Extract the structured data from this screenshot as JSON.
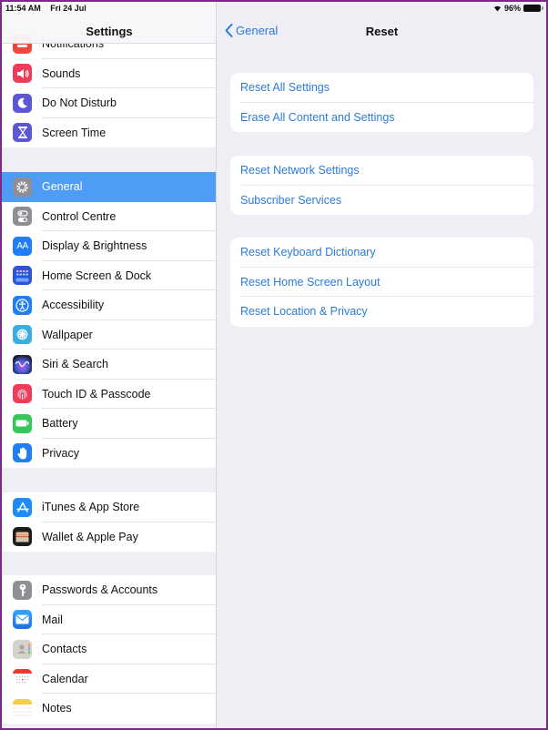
{
  "status_bar": {
    "time": "11:54 AM",
    "date": "Fri 24 Jul",
    "battery_percent": "96%",
    "wifi_icon": "wifi-icon",
    "battery_icon": "battery-icon"
  },
  "master": {
    "title": "Settings",
    "groups": [
      {
        "items": [
          {
            "label": "Notifications",
            "icon": "notifications-icon",
            "color": "#f2453d"
          },
          {
            "label": "Sounds",
            "icon": "speaker-icon",
            "color": "#f03a5a"
          },
          {
            "label": "Do Not Disturb",
            "icon": "moon-icon",
            "color": "#5b57d6"
          },
          {
            "label": "Screen Time",
            "icon": "hourglass-icon",
            "color": "#5b57d6"
          }
        ]
      },
      {
        "items": [
          {
            "label": "General",
            "icon": "gear-icon",
            "color": "#8e8e93",
            "selected": true
          },
          {
            "label": "Control Centre",
            "icon": "toggles-icon",
            "color": "#8e8e93"
          },
          {
            "label": "Display & Brightness",
            "icon": "text-size-icon",
            "color": "#1f7ef5"
          },
          {
            "label": "Home Screen & Dock",
            "icon": "home-grid-icon",
            "color": "#2c55d6"
          },
          {
            "label": "Accessibility",
            "icon": "accessibility-icon",
            "color": "#1f7ef5"
          },
          {
            "label": "Wallpaper",
            "icon": "flower-icon",
            "color": "#3aaee2"
          },
          {
            "label": "Siri & Search",
            "icon": "siri-icon",
            "color": "#2a2a54"
          },
          {
            "label": "Touch ID & Passcode",
            "icon": "fingerprint-icon",
            "color": "#f03a5a"
          },
          {
            "label": "Battery",
            "icon": "battery-app-icon",
            "color": "#34c759"
          },
          {
            "label": "Privacy",
            "icon": "hand-icon",
            "color": "#1f7ef5"
          }
        ]
      },
      {
        "items": [
          {
            "label": "iTunes & App Store",
            "icon": "app-store-icon",
            "color": "#1d8cf5"
          },
          {
            "label": "Wallet & Apple Pay",
            "icon": "wallet-icon",
            "color": "#1c1c1e"
          }
        ]
      },
      {
        "items": [
          {
            "label": "Passwords & Accounts",
            "icon": "key-icon",
            "color": "#8e8e93"
          },
          {
            "label": "Mail",
            "icon": "mail-icon",
            "color": "#1e90f5"
          },
          {
            "label": "Contacts",
            "icon": "contacts-icon",
            "color": "#c9c6c0"
          },
          {
            "label": "Calendar",
            "icon": "calendar-icon",
            "color": "#ffffff"
          },
          {
            "label": "Notes",
            "icon": "notes-icon",
            "color": "#ffffff"
          }
        ]
      }
    ]
  },
  "detail": {
    "back_label": "General",
    "title": "Reset",
    "groups": [
      {
        "items": [
          "Reset All Settings",
          "Erase All Content and Settings"
        ]
      },
      {
        "items": [
          "Reset Network Settings",
          "Subscriber Services"
        ]
      },
      {
        "items": [
          "Reset Keyboard Dictionary",
          "Reset Home Screen Layout",
          "Reset Location & Privacy"
        ]
      }
    ]
  },
  "colors": {
    "accent": "#2b7bd8",
    "selected_row": "#4f9cf6",
    "background": "#efeef4"
  }
}
